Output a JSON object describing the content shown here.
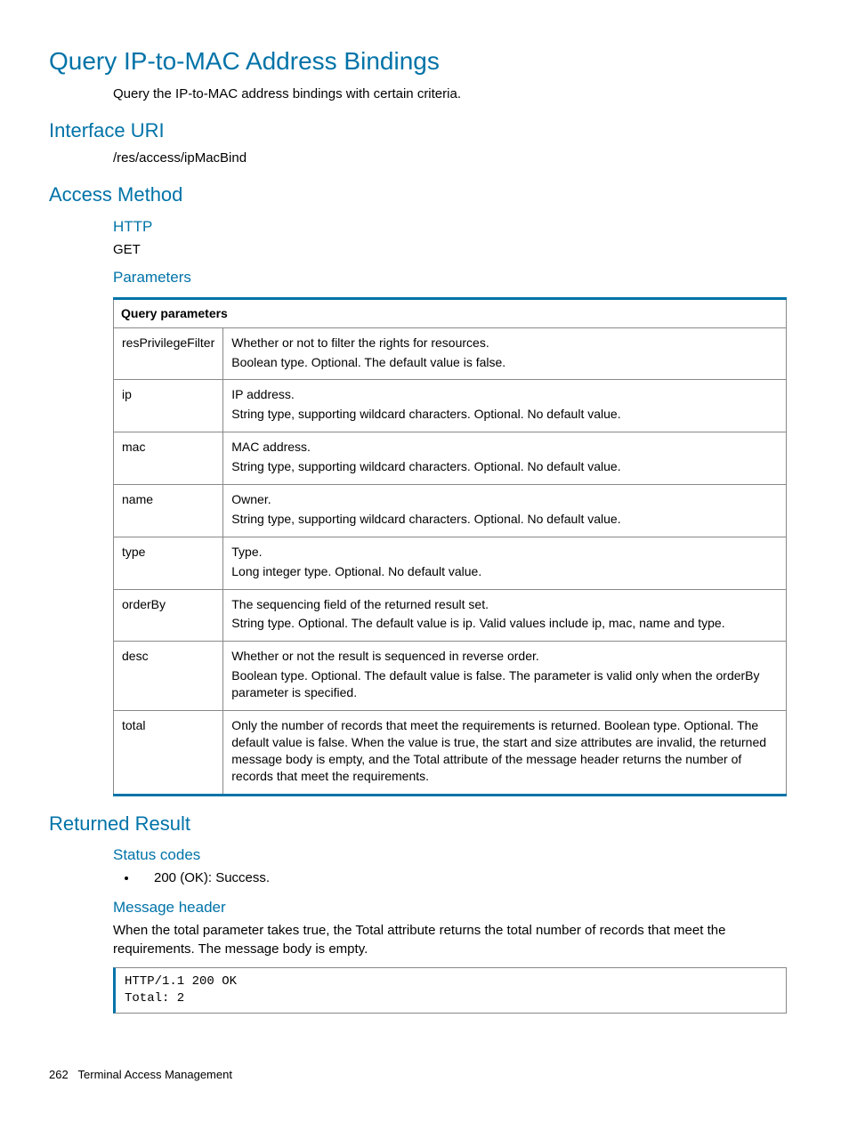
{
  "title": "Query IP-to-MAC Address Bindings",
  "subtitle": "Query the IP-to-MAC address bindings with certain criteria.",
  "sections": {
    "interface_uri": {
      "heading": "Interface URI",
      "value": "/res/access/ipMacBind"
    },
    "access_method": {
      "heading": "Access Method",
      "http_heading": "HTTP",
      "http_value": "GET",
      "params_heading": "Parameters"
    },
    "returned_result": {
      "heading": "Returned Result",
      "status_heading": "Status codes",
      "status_item": "200 (OK): Success.",
      "msg_heading": "Message header",
      "msg_body": "When the total parameter takes true, the Total attribute returns the total number of records that meet the requirements. The message body is empty.",
      "code": "HTTP/1.1 200 OK\nTotal: 2"
    }
  },
  "table": {
    "header": "Query parameters",
    "rows": [
      {
        "name": "resPrivilegeFilter",
        "lines": [
          "Whether or not to filter the rights for resources.",
          "Boolean type. Optional. The default value is false."
        ]
      },
      {
        "name": "ip",
        "lines": [
          "IP address.",
          "String type, supporting wildcard characters. Optional. No default value."
        ]
      },
      {
        "name": "mac",
        "lines": [
          "MAC address.",
          "String type, supporting wildcard characters. Optional. No default value."
        ]
      },
      {
        "name": "name",
        "lines": [
          "Owner.",
          "String type, supporting wildcard characters. Optional. No default value."
        ]
      },
      {
        "name": "type",
        "lines": [
          "Type.",
          "Long integer type. Optional. No default value."
        ]
      },
      {
        "name": "orderBy",
        "lines": [
          "The sequencing field of the returned result set.",
          "String type. Optional. The default value is ip. Valid values include ip, mac, name and type."
        ]
      },
      {
        "name": "desc",
        "lines": [
          "Whether or not the result is sequenced in reverse order.",
          "Boolean type. Optional. The default value is false. The parameter is valid only when the orderBy parameter is specified."
        ]
      },
      {
        "name": "total",
        "lines": [
          "Only the number of records that meet the requirements is returned. Boolean type. Optional. The default value is false. When the value is true, the start and size attributes are invalid, the returned message body is empty, and the Total attribute of the message header returns the number of records that meet the requirements."
        ]
      }
    ]
  },
  "footer": {
    "page": "262",
    "section": "Terminal Access Management"
  }
}
